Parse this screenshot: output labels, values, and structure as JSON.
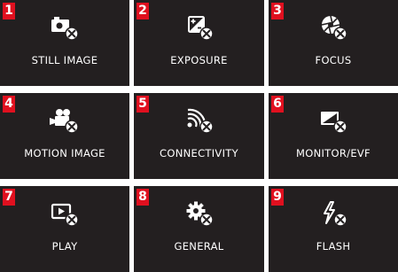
{
  "menu": {
    "tiles": [
      {
        "number": "1",
        "label": "STILL IMAGE",
        "icon": "camera-settings-icon"
      },
      {
        "number": "2",
        "label": "EXPOSURE",
        "icon": "exposure-settings-icon"
      },
      {
        "number": "3",
        "label": "FOCUS",
        "icon": "aperture-settings-icon"
      },
      {
        "number": "4",
        "label": "MOTION IMAGE",
        "icon": "video-camera-settings-icon"
      },
      {
        "number": "5",
        "label": "CONNECTIVITY",
        "icon": "wireless-settings-icon"
      },
      {
        "number": "6",
        "label": "MONITOR/EVF",
        "icon": "monitor-settings-icon"
      },
      {
        "number": "7",
        "label": "PLAY",
        "icon": "playback-settings-icon"
      },
      {
        "number": "8",
        "label": "GENERAL",
        "icon": "gear-settings-icon"
      },
      {
        "number": "9",
        "label": "FLASH",
        "icon": "flash-settings-icon"
      }
    ]
  },
  "colors": {
    "tile_background": "#231f20",
    "number_badge": "#e0101f",
    "text": "#ffffff"
  }
}
